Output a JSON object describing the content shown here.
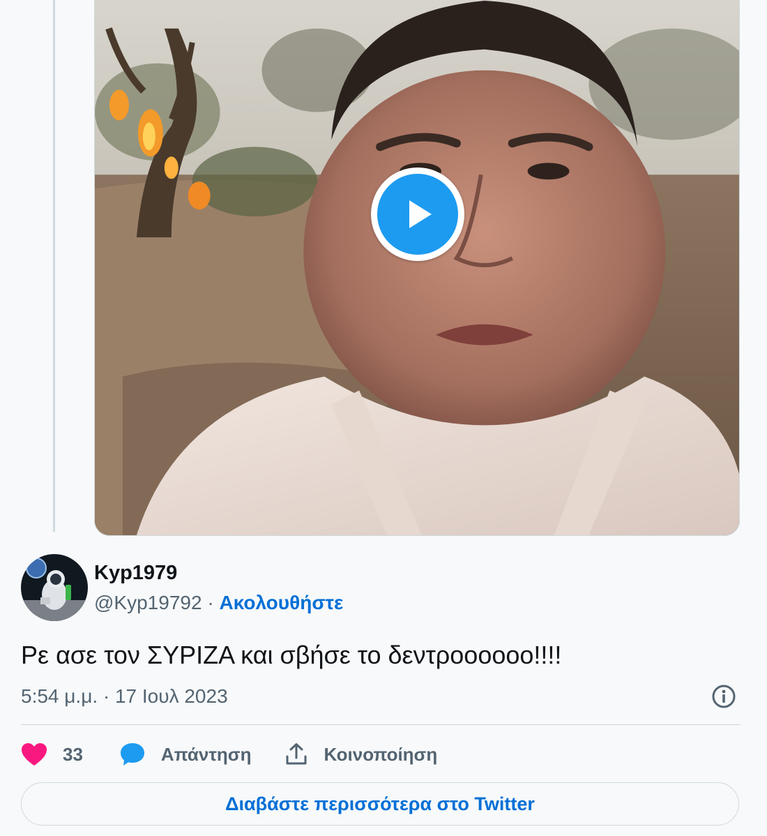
{
  "media": {
    "type": "video",
    "play_icon": "play-icon"
  },
  "tweet": {
    "display_name": "Kyp1979",
    "handle": "@Kyp19792",
    "separator": "·",
    "follow_label": "Ακολουθήστε",
    "text": "Ρε ασε τον ΣΥΡΙΖΑ και σβήσε το δεντροοοοοο!!!!",
    "timestamp": "5:54 μ.μ. · 17 Ιουλ 2023",
    "info_icon": "info-icon"
  },
  "actions": {
    "like_count": "33",
    "like_icon": "heart-icon",
    "reply_label": "Απάντηση",
    "reply_icon": "speech-bubble-icon",
    "share_label": "Κοινοποίηση",
    "share_icon": "share-upload-icon"
  },
  "read_more_label": "Διαβάστε περισσότερα στο Twitter",
  "colors": {
    "accent": "#1d9bf0",
    "link": "#006fd6",
    "like": "#f91880",
    "secondary_text": "#536471",
    "border": "#cfd9de"
  }
}
